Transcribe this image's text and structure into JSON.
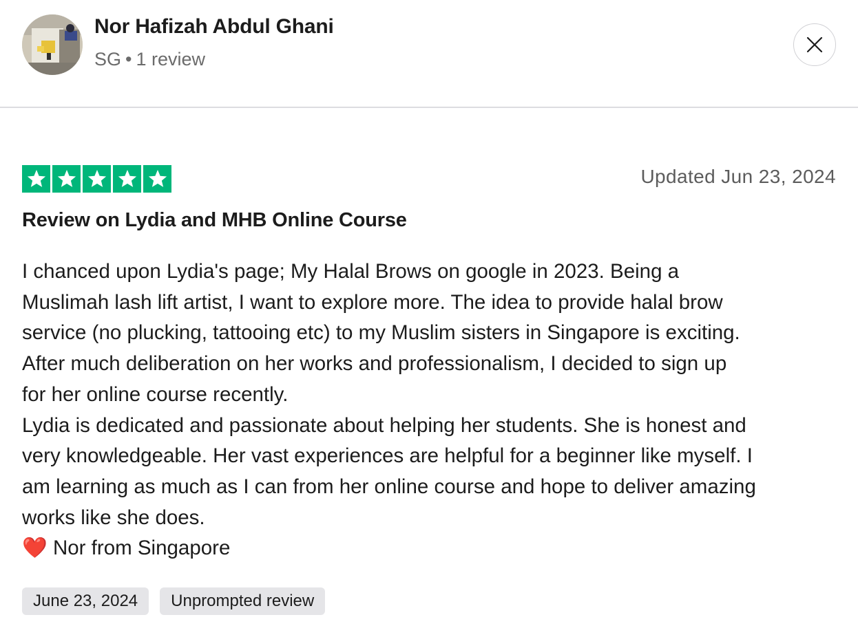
{
  "reviewer": {
    "name": "Nor Hafizah Abdul Ghani",
    "country": "SG",
    "separator": "•",
    "review_count": "1 review"
  },
  "icons": {
    "close": "close-icon",
    "star": "star-icon",
    "heart": "heart-icon"
  },
  "review": {
    "rating": 5,
    "rating_max": 5,
    "star_color": "#00b67a",
    "updated": "Updated Jun 23, 2024",
    "title": "Review on Lydia and MHB Online Course",
    "body_lines": [
      "I chanced upon Lydia's page; My Halal Brows on google in 2023. Being a",
      "Muslimah lash lift artist, I want to explore more. The idea to provide halal brow",
      "service (no plucking, tattooing etc) to my Muslim sisters in Singapore is exciting.",
      "After much deliberation on her works and professionalism, I decided to sign up",
      "for her online course recently.",
      "Lydia is dedicated and passionate about helping her students. She is honest and",
      "very knowledgeable. Her vast experiences are helpful for a beginner like myself. I",
      "am learning as much as I can from her online course and hope to deliver amazing",
      "works like she does."
    ],
    "signoff_heart": "❤️",
    "signoff": "Nor from Singapore",
    "tags": {
      "date": "June 23, 2024",
      "type": "Unprompted review"
    }
  }
}
